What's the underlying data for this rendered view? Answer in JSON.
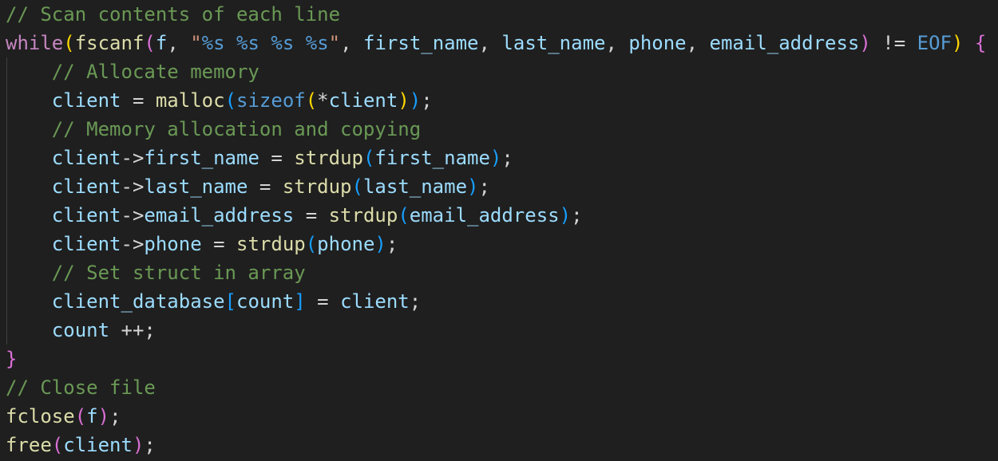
{
  "code": {
    "line_01": {
      "comment": "// Scan contents of each line"
    },
    "line_02": {
      "kw_while": "while",
      "b1_open": "(",
      "fn_fscanf": "fscanf",
      "b2_open": "(",
      "var_f": "f",
      "comma_1": ", ",
      "str_open": "\"",
      "fmt_1": "%s",
      "sp_1": " ",
      "fmt_2": "%s",
      "sp_2": " ",
      "fmt_3": "%s",
      "sp_3": " ",
      "fmt_4": "%s",
      "str_close": "\"",
      "comma_2": ", ",
      "var_first_name": "first_name",
      "comma_3": ", ",
      "var_last_name": "last_name",
      "comma_4": ", ",
      "var_phone": "phone",
      "comma_5": ", ",
      "var_email_address": "email_address",
      "b2_close": ")",
      "op_ne": " != ",
      "const_eof": "EOF",
      "b1_close": ")",
      "space": " ",
      "brace_open": "{"
    },
    "line_03": {
      "indent": "    ",
      "comment": "// Allocate memory"
    },
    "line_04": {
      "indent": "    ",
      "var_client": "client",
      "op_eq": " = ",
      "fn_malloc": "malloc",
      "b3_open": "(",
      "kw_sizeof": "sizeof",
      "b1_open": "(",
      "op_deref": "*",
      "var_client2": "client",
      "b1_close": ")",
      "b3_close": ")",
      "semi": ";"
    },
    "line_05": {
      "indent": "    ",
      "comment": "// Memory allocation and copying"
    },
    "line_06": {
      "indent": "    ",
      "var_client": "client",
      "op_arrow": "->",
      "var_member": "first_name",
      "op_eq": " = ",
      "fn_strdup": "strdup",
      "b3_open": "(",
      "var_arg": "first_name",
      "b3_close": ")",
      "semi": ";"
    },
    "line_07": {
      "indent": "    ",
      "var_client": "client",
      "op_arrow": "->",
      "var_member": "last_name",
      "op_eq": " = ",
      "fn_strdup": "strdup",
      "b3_open": "(",
      "var_arg": "last_name",
      "b3_close": ")",
      "semi": ";"
    },
    "line_08": {
      "indent": "    ",
      "var_client": "client",
      "op_arrow": "->",
      "var_member": "email_address",
      "op_eq": " = ",
      "fn_strdup": "strdup",
      "b3_open": "(",
      "var_arg": "email_address",
      "b3_close": ")",
      "semi": ";"
    },
    "line_09": {
      "indent": "    ",
      "var_client": "client",
      "op_arrow": "->",
      "var_member": "phone",
      "op_eq": " = ",
      "fn_strdup": "strdup",
      "b3_open": "(",
      "var_arg": "phone",
      "b3_close": ")",
      "semi": ";"
    },
    "line_10": {
      "indent": "    ",
      "comment": "// Set struct in array"
    },
    "line_11": {
      "indent": "    ",
      "var_db": "client_database",
      "b3_open": "[",
      "var_count": "count",
      "b3_close": "]",
      "op_eq": " = ",
      "var_client": "client",
      "semi": ";"
    },
    "line_12": {
      "indent": "    ",
      "var_count": "count",
      "op_inc": " ++",
      "semi": ";"
    },
    "line_13": {
      "brace_close": "}"
    },
    "line_14": {
      "comment": "// Close file"
    },
    "line_15": {
      "fn_fclose": "fclose",
      "b2_open": "(",
      "var_f": "f",
      "b2_close": ")",
      "semi": ";"
    },
    "line_16": {
      "fn_free": "free",
      "b2_open": "(",
      "var_client": "client",
      "b2_close": ")",
      "semi": ";"
    }
  },
  "colors": {
    "background": "#1f1f1f",
    "comment": "#6a9955",
    "keyword": "#c586c0",
    "function": "#dcdcaa",
    "variable": "#9cdcfe",
    "string": "#ce9178",
    "constant": "#4fc1ff",
    "bracket_gold": "#ffd700",
    "bracket_orchid": "#da70d6",
    "bracket_blue": "#179fff"
  }
}
